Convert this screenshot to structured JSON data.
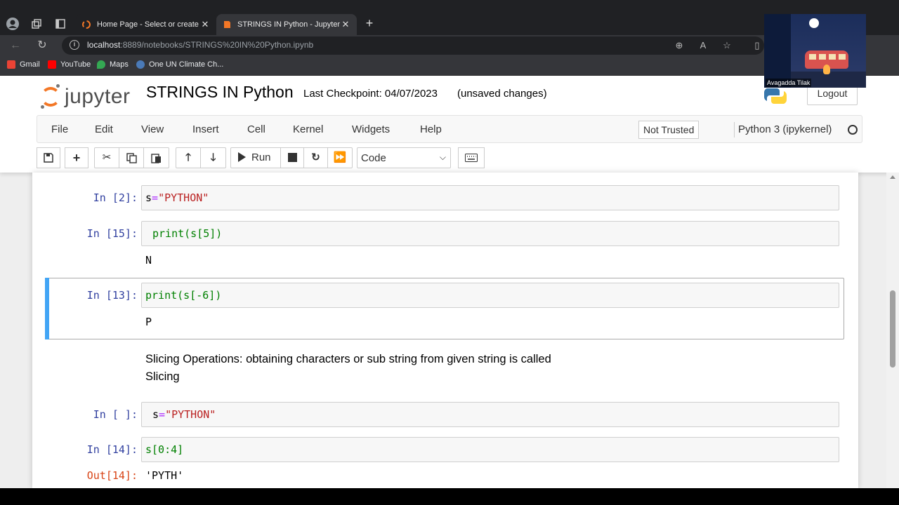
{
  "browser": {
    "tabs": [
      {
        "title": "Home Page - Select or create a notebook",
        "active": false
      },
      {
        "title": "STRINGS IN Python - Jupyter Notebook",
        "active": true
      }
    ],
    "url_host": "localhost",
    "url_rest": ":8889/notebooks/STRINGS%20IN%20Python.ipynb",
    "bookmarks": [
      {
        "label": "Gmail",
        "color": "#ea4335"
      },
      {
        "label": "YouTube",
        "color": "#ff0000"
      },
      {
        "label": "Maps",
        "color": "#34a853"
      },
      {
        "label": "One UN Climate Ch...",
        "color": "#4a7ab8"
      }
    ],
    "webcam_name": "Avagadda Tilak"
  },
  "header": {
    "logo_text": "jupyter",
    "notebook_name": "STRINGS IN Python",
    "checkpoint": "Last Checkpoint: 04/07/2023",
    "unsaved": "(unsaved changes)",
    "logout_label": "Logout"
  },
  "menu": {
    "items": [
      "File",
      "Edit",
      "View",
      "Insert",
      "Cell",
      "Kernel",
      "Widgets",
      "Help"
    ],
    "trusted_label": "Not Trusted",
    "kernel_name": "Python 3 (ipykernel)"
  },
  "toolbar": {
    "run_label": "Run",
    "cell_type": "Code"
  },
  "cells": [
    {
      "prompt": "In [2]:",
      "code_var": "s",
      "code_op": "=",
      "code_str": "\"PYTHON\""
    },
    {
      "prompt": "In [15]:",
      "code": "print(s[5])",
      "output": "N"
    },
    {
      "prompt": "In [13]:",
      "code": "print(s[-6])",
      "output": "P"
    },
    {
      "markdown_line1": "Slicing Operations: obtaining characters or sub string from given string is called",
      "markdown_line2": "Slicing"
    },
    {
      "prompt": "In [ ]:",
      "code_var": "s",
      "code_op": "=",
      "code_str": "\"PYTHON\""
    },
    {
      "prompt": "In [14]:",
      "code": "s[0:4]",
      "out_prompt": "Out[14]:",
      "output": "'PYTH'"
    }
  ],
  "colors": {
    "accent": "#f37726",
    "selected_bar": "#42a5f5",
    "prompt_in": "#303f9f",
    "prompt_out": "#d84315"
  }
}
